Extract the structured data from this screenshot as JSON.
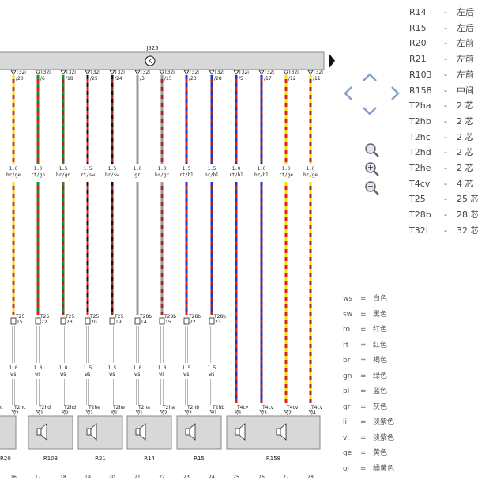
{
  "header": {
    "control_unit": "J525",
    "symbol": "K"
  },
  "wires": [
    {
      "top_pin": "T32i",
      "top_num": "/20",
      "size": "1.0",
      "color_code": "br/ge",
      "c1": "#c0392b",
      "c2": "#f5e000",
      "lower_size": "",
      "lower_color": "",
      "lower_c1": "#c0392b",
      "lower_c2": "#f5e000",
      "conn_name": "T25",
      "conn_pin": "15",
      "bottom_conn": "T2hc",
      "bottom_pin": "2"
    },
    {
      "top_pin": "T32i",
      "top_num": "/6",
      "size": "1.0",
      "color_code": "rt/gn",
      "c1": "#e02020",
      "c2": "#1a8f2a",
      "lower_size": "",
      "lower_color": "",
      "lower_c1": "#e02020",
      "lower_c2": "#1a8f2a",
      "conn_name": "T25",
      "conn_pin": "22",
      "bottom_conn": "T2hd",
      "bottom_pin": "1"
    },
    {
      "top_pin": "T32i",
      "top_num": "/18",
      "size": "1.5",
      "color_code": "br/gn",
      "c1": "#9b2c2c",
      "c2": "#1a8f2a",
      "lower_size": "",
      "lower_color": "",
      "lower_c1": "#9b2c2c",
      "lower_c2": "#1a8f2a",
      "conn_name": "T25",
      "conn_pin": "23",
      "bottom_conn": "T2hd",
      "bottom_pin": "2"
    },
    {
      "top_pin": "T32i",
      "top_num": "/25",
      "size": "1.5",
      "color_code": "rt/sw",
      "c1": "#e02020",
      "c2": "#111111",
      "lower_size": "",
      "lower_color": "",
      "lower_c1": "#e02020",
      "lower_c2": "#111111",
      "conn_name": "T25",
      "conn_pin": "20",
      "bottom_conn": "T2he",
      "bottom_pin": "2"
    },
    {
      "top_pin": "T32i",
      "top_num": "/24",
      "size": "1.5",
      "color_code": "br/sw",
      "c1": "#9b2c2c",
      "c2": "#111111",
      "lower_size": "",
      "lower_color": "",
      "lower_c1": "#9b2c2c",
      "lower_c2": "#111111",
      "conn_name": "T25",
      "conn_pin": "19",
      "bottom_conn": "T2he",
      "bottom_pin": "1"
    },
    {
      "top_pin": "T32i",
      "top_num": "/3",
      "size": "1.0",
      "color_code": "gr",
      "c1": "#9a9a9a",
      "c2": "#9a9a9a",
      "lower_size": "",
      "lower_color": "",
      "lower_c1": "#9a9a9a",
      "lower_c2": "#9a9a9a",
      "conn_name": "T28b",
      "conn_pin": "14",
      "bottom_conn": "T2ha",
      "bottom_pin": "1"
    },
    {
      "top_pin": "T32i",
      "top_num": "/15",
      "size": "1.0",
      "color_code": "br/gr",
      "c1": "#9b2c2c",
      "c2": "#9a9a9a",
      "lower_size": "",
      "lower_color": "",
      "lower_c1": "#9b2c2c",
      "lower_c2": "#9a9a9a",
      "conn_name": "T28b",
      "conn_pin": "15",
      "bottom_conn": "T2ha",
      "bottom_pin": "2"
    },
    {
      "top_pin": "T32i",
      "top_num": "/23",
      "size": "1.5",
      "color_code": "rt/bl",
      "c1": "#e02020",
      "c2": "#2233cc",
      "lower_size": "",
      "lower_color": "",
      "lower_c1": "#e02020",
      "lower_c2": "#2233cc",
      "conn_name": "T28b",
      "conn_pin": "22",
      "bottom_conn": "T2hb",
      "bottom_pin": "2"
    },
    {
      "top_pin": "T32i",
      "top_num": "/28",
      "size": "1.5",
      "color_code": "br/bl",
      "c1": "#9b2c2c",
      "c2": "#2233cc",
      "lower_size": "",
      "lower_color": "",
      "lower_c1": "#9b2c2c",
      "lower_c2": "#2233cc",
      "conn_name": "T28b",
      "conn_pin": "23",
      "bottom_conn": "T2hb",
      "bottom_pin": "1"
    },
    {
      "top_pin": "T32i",
      "top_num": "/5",
      "size": "1.0",
      "color_code": "rt/bl",
      "c1": "#e02020",
      "c2": "#2233cc",
      "lower_size": "",
      "lower_color": "",
      "lower_c1": "#e02020",
      "lower_c2": "#2233cc",
      "conn_name": "",
      "conn_pin": "",
      "bottom_conn": "T4cv",
      "bottom_pin": "1"
    },
    {
      "top_pin": "T32i",
      "top_num": "/17",
      "size": "1.0",
      "color_code": "br/bl",
      "c1": "#9b2c2c",
      "c2": "#2233cc",
      "lower_size": "",
      "lower_color": "",
      "lower_c1": "#9b2c2c",
      "lower_c2": "#2233cc",
      "conn_name": "",
      "conn_pin": "",
      "bottom_conn": "T4cv",
      "bottom_pin": "3"
    },
    {
      "top_pin": "T32i",
      "top_num": "/12",
      "size": "1.0",
      "color_code": "rt/ge",
      "c1": "#e02020",
      "c2": "#f5e000",
      "lower_size": "",
      "lower_color": "",
      "lower_c1": "#e02020",
      "lower_c2": "#f5e000",
      "conn_name": "",
      "conn_pin": "",
      "bottom_conn": "T4cv",
      "bottom_pin": "2"
    },
    {
      "top_pin": "T32i",
      "top_num": "/11",
      "size": "1.0",
      "color_code": "br/ge",
      "c1": "#9b2c2c",
      "c2": "#f5e000",
      "lower_size": "",
      "lower_color": "",
      "lower_c1": "#9b2c2c",
      "lower_c2": "#f5e000",
      "conn_name": "",
      "conn_pin": "",
      "bottom_conn": "T4cv",
      "bottom_pin": "4"
    }
  ],
  "lower_wire_labels": [
    {
      "size": "1.0",
      "color": "ws"
    },
    {
      "size": "1.0",
      "color": "ws"
    },
    {
      "size": "1.0",
      "color": "ws"
    },
    {
      "size": "1.5",
      "color": "ws"
    },
    {
      "size": "1.5",
      "color": "ws"
    },
    {
      "size": "1.0",
      "color": "ws"
    },
    {
      "size": "1.0",
      "color": "ws"
    },
    {
      "size": "1.5",
      "color": "ws"
    },
    {
      "size": "1.5",
      "color": "ws"
    }
  ],
  "partial_conn": {
    "label": "c",
    "bottom_label": "R20"
  },
  "speakers": [
    {
      "name": "R103",
      "left_conn": "T2hd",
      "right_conn": "T2hd"
    },
    {
      "name": "R21",
      "left_conn": "T2he",
      "right_conn": "T2he"
    },
    {
      "name": "R14",
      "left_conn": "T2ha",
      "right_conn": "T2ha"
    },
    {
      "name": "R15",
      "left_conn": "T2hb",
      "right_conn": "T2hb"
    },
    {
      "name": "R158",
      "left_conn": "T4cv",
      "right_conn": "T4cv"
    }
  ],
  "column_numbers": [
    "16",
    "17",
    "18",
    "19",
    "20",
    "21",
    "22",
    "23",
    "24",
    "25",
    "26",
    "27",
    "28"
  ],
  "legend": [
    {
      "code": "R14",
      "desc": "左后"
    },
    {
      "code": "R15",
      "desc": "左后"
    },
    {
      "code": "R20",
      "desc": "左前"
    },
    {
      "code": "R21",
      "desc": "左前"
    },
    {
      "code": "R103",
      "desc": "左前"
    },
    {
      "code": "R158",
      "desc": "中间"
    },
    {
      "code": "T2ha",
      "desc": "2 芯"
    },
    {
      "code": "T2hb",
      "desc": "2 芯"
    },
    {
      "code": "T2hc",
      "desc": "2 芯"
    },
    {
      "code": "T2hd",
      "desc": "2 芯"
    },
    {
      "code": "T2he",
      "desc": "2 芯"
    },
    {
      "code": "T4cv",
      "desc": "4 芯"
    },
    {
      "code": "T25",
      "desc": "25 芯"
    },
    {
      "code": "T28b",
      "desc": "28 芯"
    },
    {
      "code": "T32i",
      "desc": "32 芯"
    }
  ],
  "legend_dash": "-",
  "color_legend": [
    {
      "abbr": "ws",
      "name": "白色"
    },
    {
      "abbr": "sw",
      "name": "黑色"
    },
    {
      "abbr": "ro",
      "name": "红色"
    },
    {
      "abbr": "rt",
      "name": "红色"
    },
    {
      "abbr": "br",
      "name": "褐色"
    },
    {
      "abbr": "gn",
      "name": "绿色"
    },
    {
      "abbr": "bl",
      "name": "蓝色"
    },
    {
      "abbr": "gr",
      "name": "灰色"
    },
    {
      "abbr": "li",
      "name": "淡紫色"
    },
    {
      "abbr": "vi",
      "name": "淡紫色"
    },
    {
      "abbr": "ge",
      "name": "黄色"
    },
    {
      "abbr": "or",
      "name": "橘黄色"
    }
  ],
  "color_eq": "=",
  "nav_icons": [
    "up-arrow",
    "left-arrow",
    "right-arrow",
    "down-arrow"
  ],
  "zoom_icons": [
    "zoom-icon",
    "zoom-in-icon",
    "zoom-out-icon"
  ]
}
